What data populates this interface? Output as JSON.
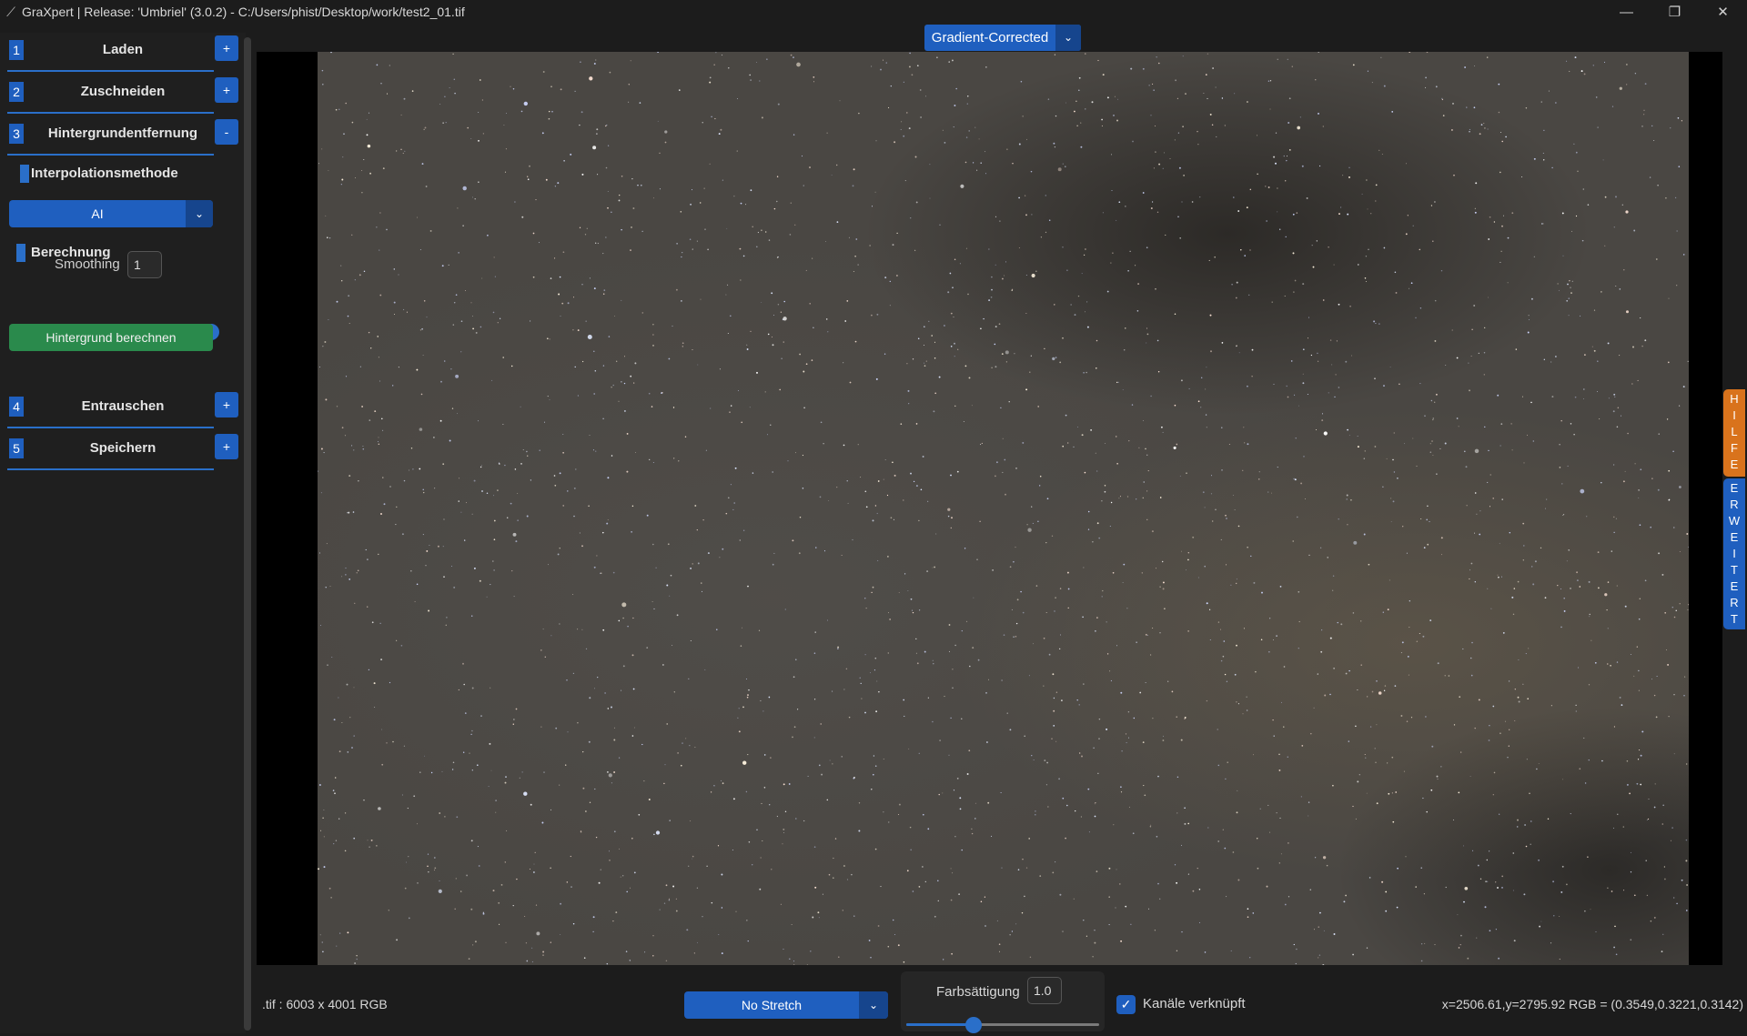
{
  "window": {
    "title": "GraXpert | Release: 'Umbriel' (3.0.2) - C:/Users/phist/Desktop/work/test2_01.tif",
    "app_icon": "⟋",
    "minimize": "—",
    "maximize": "❐",
    "close": "✕"
  },
  "sidebar": {
    "sections": [
      {
        "num": "1",
        "title": "Laden",
        "toggle": "+"
      },
      {
        "num": "2",
        "title": "Zuschneiden",
        "toggle": "+"
      },
      {
        "num": "3",
        "title": "Hintergrundentfernung",
        "toggle": "-"
      },
      {
        "num": "4",
        "title": "Entrauschen",
        "toggle": "+"
      },
      {
        "num": "5",
        "title": "Speichern",
        "toggle": "+"
      }
    ],
    "interpolation_label": "Interpolationsmethode",
    "interpolation_value": "AI",
    "calculation_label": "Berechnung",
    "smoothing_label": "Smoothing",
    "smoothing_value": "1",
    "smoothing_level": 1.0,
    "calc_button": "Hintergrund berechnen"
  },
  "view": {
    "selected": "Gradient-Corrected",
    "arrow": "⌄"
  },
  "side_tabs": {
    "help": [
      "H",
      "I",
      "L",
      "F",
      "E"
    ],
    "advanced": [
      "E",
      "R",
      "W",
      "E",
      "I",
      "T",
      "E",
      "R",
      "T"
    ]
  },
  "bottom": {
    "file_info": ".tif : 6003 x 4001 RGB",
    "stretch": "No Stretch",
    "saturation_label": "Farbsättigung",
    "saturation_value": "1.0",
    "saturation_level": 0.35,
    "channels_label": "Kanäle verknüpft",
    "channels_checked": "✓",
    "coords": "x=2506.61,y=2795.92  RGB = (0.3549,0.3221,0.3142)"
  },
  "colors": {
    "accent": "#1f5fbf",
    "green_button": "#2a8a4c",
    "help_tab": "#d9731c"
  }
}
